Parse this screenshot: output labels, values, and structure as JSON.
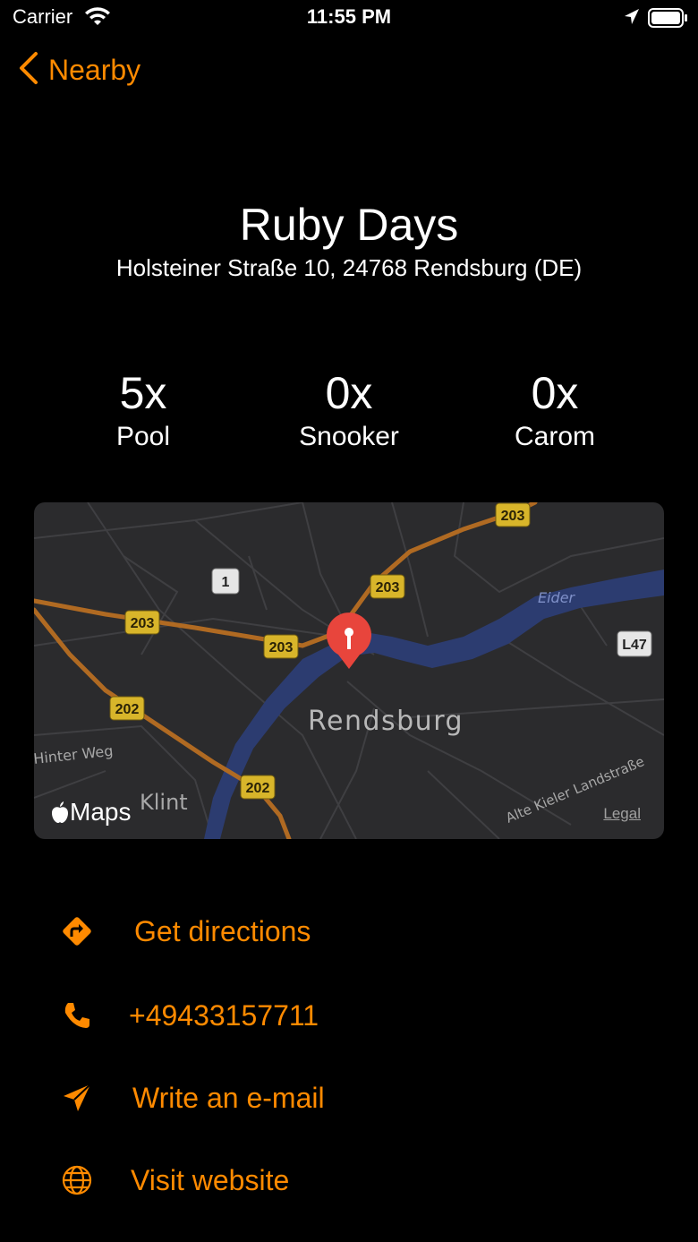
{
  "status_bar": {
    "carrier": "Carrier",
    "time": "11:55 PM"
  },
  "nav": {
    "back_label": "Nearby"
  },
  "venue": {
    "name": "Ruby Days",
    "address": "Holsteiner Straße 10, 24768 Rendsburg (DE)"
  },
  "stats": [
    {
      "count": "5x",
      "label": "Pool"
    },
    {
      "count": "0x",
      "label": "Snooker"
    },
    {
      "count": "0x",
      "label": "Carom"
    }
  ],
  "map": {
    "city_label": "Rendsburg",
    "district_label": "Klint",
    "river_label": "Eider",
    "street_labels": [
      "Hinter Weg",
      "Alte Kieler Landstraße"
    ],
    "road_shields": [
      "203",
      "203",
      "203",
      "203",
      "202",
      "202",
      "1",
      "L47"
    ],
    "brand": "Maps",
    "legal": "Legal"
  },
  "actions": {
    "directions": "Get directions",
    "phone": "+49433157711",
    "email": "Write an e-mail",
    "website": "Visit website"
  },
  "colors": {
    "accent": "#ff8a00",
    "background": "#000000",
    "map_background": "#2b2b2d",
    "pin": "#e8453c"
  }
}
